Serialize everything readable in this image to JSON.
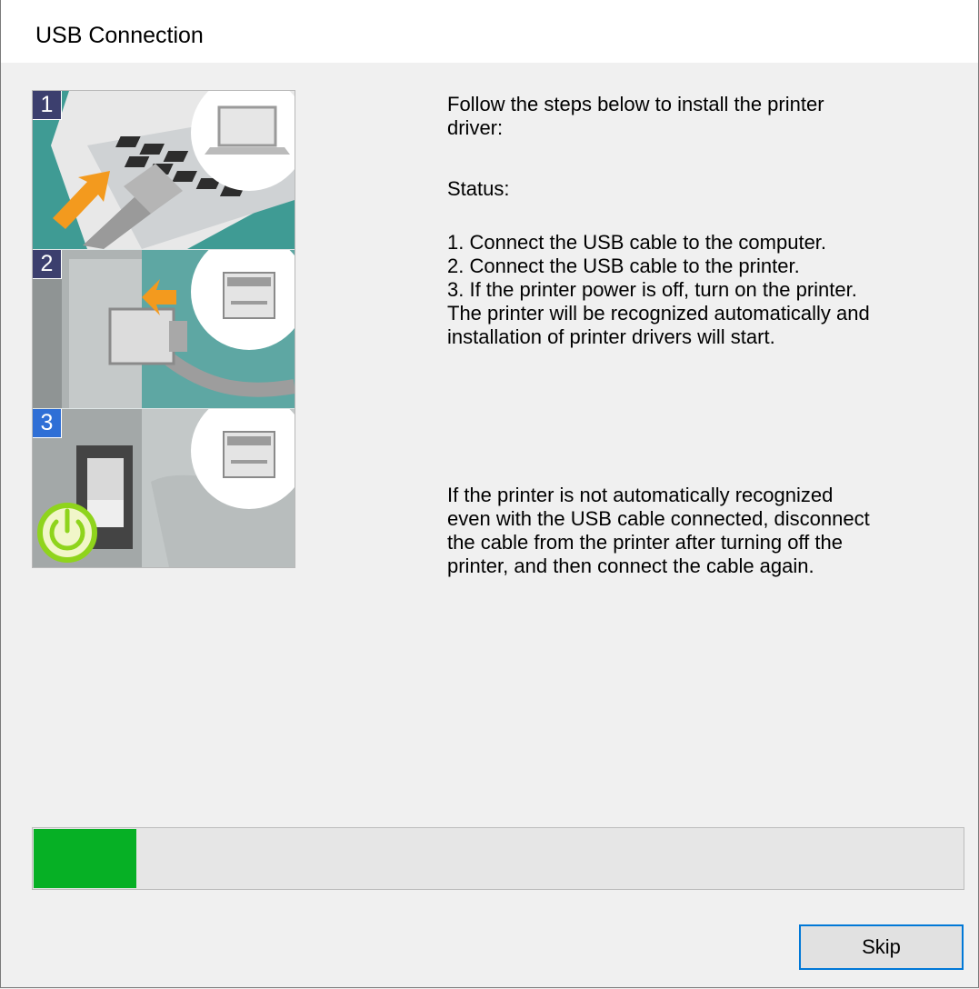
{
  "window": {
    "title": "USB Connection"
  },
  "illustration": {
    "steps": [
      {
        "number": "1",
        "badge_color": "#3c3f6e",
        "icon": "laptop-icon"
      },
      {
        "number": "2",
        "badge_color": "#3c3f6e",
        "icon": "printer-icon"
      },
      {
        "number": "3",
        "badge_color": "#2f6fd6",
        "icon": "printer-icon"
      }
    ]
  },
  "instructions": {
    "intro": "Follow the steps below to install the printer\ndriver:",
    "status_label": "Status:",
    "steps_text": "1. Connect the USB cable to the computer.\n2. Connect the USB cable to the printer.\n3. If the printer power is off, turn on the printer.\nThe printer will be recognized automatically and\ninstallation of printer drivers will start.",
    "troubleshoot": "If the printer is not automatically recognized\neven with the USB cable connected, disconnect\nthe cable from the printer after turning off the\nprinter, and then connect the cable again."
  },
  "progress": {
    "percent": 11,
    "color": "#06b025"
  },
  "buttons": {
    "skip_label": "Skip"
  },
  "colors": {
    "accent": "#0078d7",
    "background": "#f0f0f0"
  }
}
